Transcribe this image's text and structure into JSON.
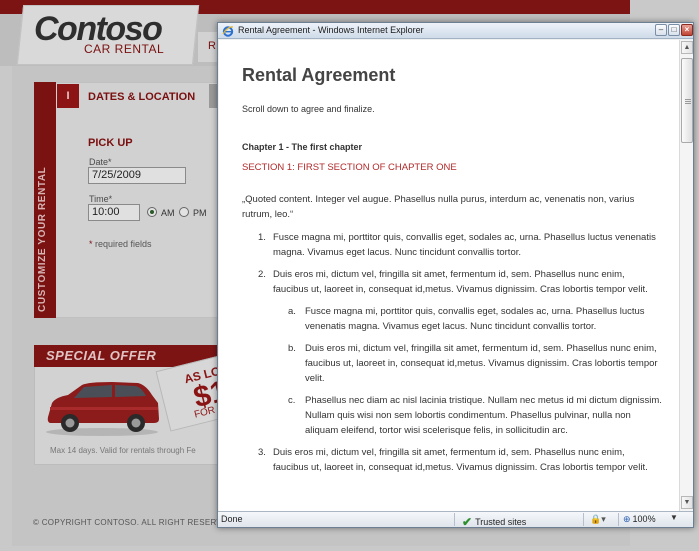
{
  "background": {
    "logo_title": "Contoso",
    "logo_subtitle": "CAR RENTAL",
    "header_tab_letter": "R",
    "sidebar_label": "CUSTOMIZE YOUR RENTAL",
    "step_number": "I",
    "step_label": "DATES & LOCATION",
    "pickup_heading": "PICK UP",
    "date_label": "Date*",
    "date_value": "7/25/2009",
    "time_label": "Time*",
    "time_value": "10:00",
    "am_label": "AM",
    "pm_label": "PM",
    "required_note": "required fields",
    "offer_title": "SPECIAL OFFER",
    "offer_tag_line1": "AS LO",
    "offer_tag_line2": "$1",
    "offer_tag_line3": "FOR C",
    "offer_note": "Max 14 days. Valid for rentals through Fe",
    "copyright": "© COPYRIGHT CONTOSO. ALL RIGHT RESERV"
  },
  "window": {
    "title": "Rental Agreement - Windows Internet Explorer",
    "minimize_glyph": "–",
    "maximize_glyph": "□",
    "close_glyph": "×"
  },
  "document": {
    "title": "Rental Agreement",
    "instruction": "Scroll down to agree and finalize.",
    "chapter": "Chapter 1 - The first chapter",
    "section": "SECTION 1: FIRST SECTION OF CHAPTER ONE",
    "quote": "„Quoted content. Integer vel augue. Phasellus nulla purus, interdum ac, venenatis non, varius rutrum, leo.“",
    "items": [
      {
        "num": "1.",
        "text": "Fusce magna mi, porttitor quis, convallis eget, sodales ac, urna. Phasellus luctus venenatis magna. Vivamus eget lacus. Nunc tincidunt convallis tortor."
      },
      {
        "num": "2.",
        "text": "Duis eros mi, dictum vel, fringilla sit amet, fermentum id, sem. Phasellus nunc enim, faucibus ut, laoreet in, consequat id,metus. Vivamus dignissim. Cras lobortis tempor velit."
      },
      {
        "num": "3.",
        "text": "Duis eros mi, dictum vel, fringilla sit amet, fermentum id, sem. Phasellus nunc enim, faucibus ut, laoreet in, consequat id,metus. Vivamus dignissim. Cras lobortis tempor velit."
      }
    ],
    "subitems": [
      {
        "num": "a.",
        "text": "Fusce magna mi, porttitor quis, convallis eget, sodales ac, urna. Phasellus luctus venenatis magna. Vivamus eget lacus. Nunc tincidunt convallis tortor."
      },
      {
        "num": "b.",
        "text": "Duis eros mi, dictum vel, fringilla sit amet, fermentum id, sem. Phasellus nunc enim, faucibus ut, laoreet in, consequat id,metus. Vivamus dignissim. Cras lobortis tempor velit."
      },
      {
        "num": "c.",
        "text": "Phasellus nec diam ac nisl lacinia tristique. Nullam nec metus id mi dictum dignissim. Nullam quis wisi non sem lobortis condimentum. Phasellus pulvinar, nulla non aliquam eleifend, tortor wisi scelerisque felis, in sollicitudin arc."
      }
    ]
  },
  "statusbar": {
    "status": "Done",
    "zone": "Trusted sites",
    "zoom": "100%"
  },
  "colors": {
    "brand_red": "#7a1212",
    "section_red": "#b12a2a",
    "trusted_green": "#2f8f2f"
  },
  "icons": [
    "ie-logo-icon",
    "minimize-icon",
    "maximize-icon",
    "close-icon",
    "scroll-up-icon",
    "scroll-down-icon",
    "checkmark-icon",
    "security-lock-icon",
    "zoom-icon",
    "chevron-down-icon"
  ]
}
